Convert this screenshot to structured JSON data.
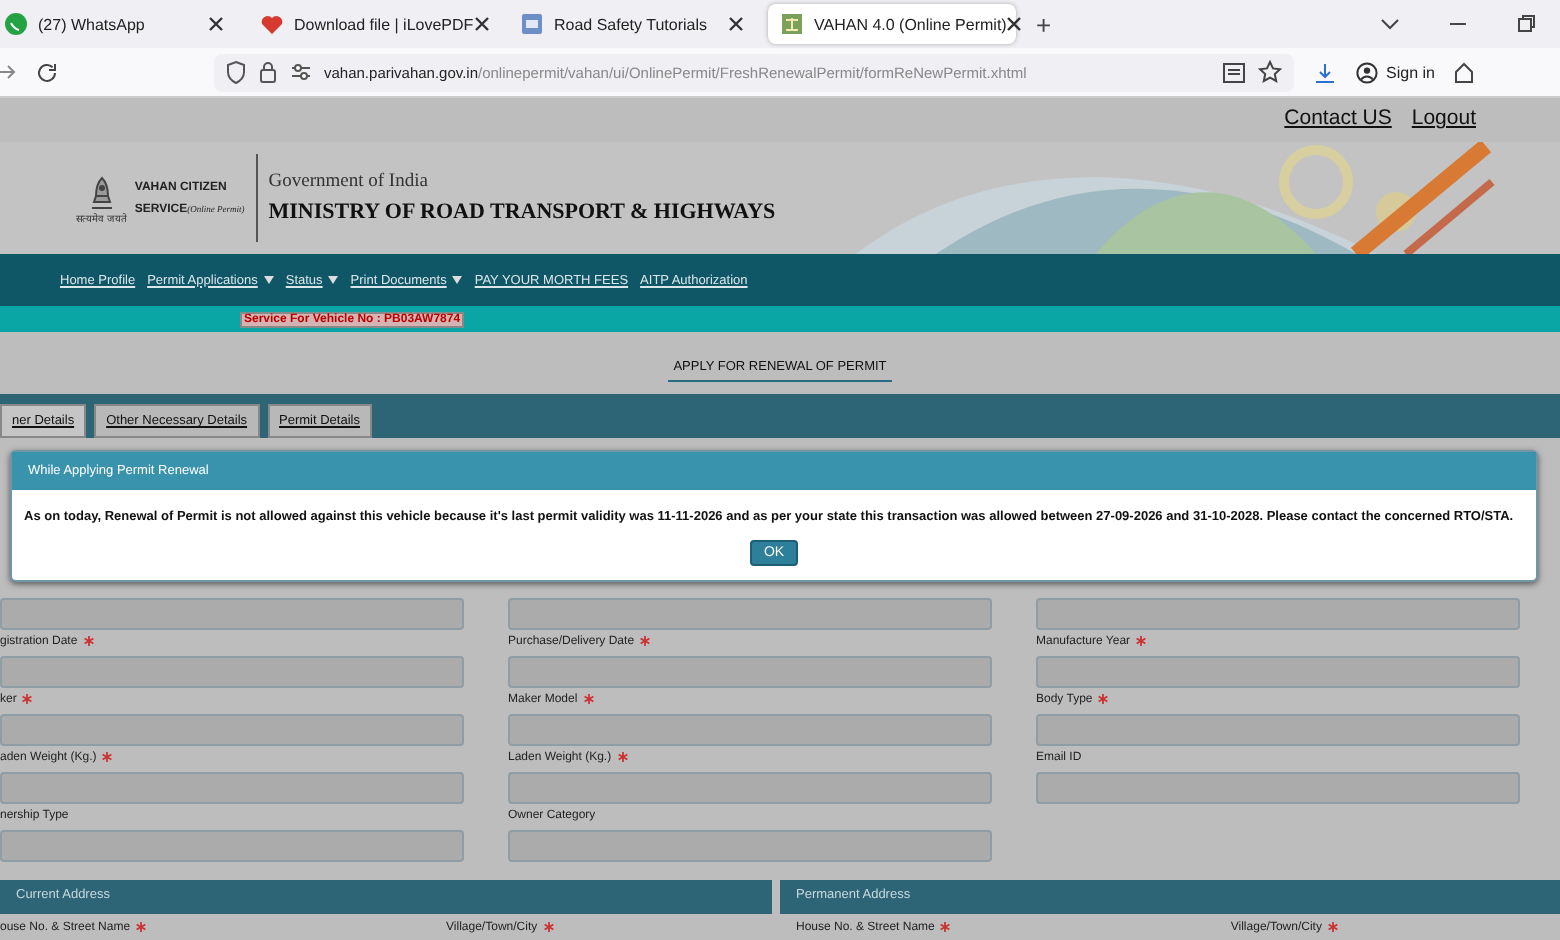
{
  "browser": {
    "tabs": [
      {
        "title": "(27) WhatsApp",
        "selected": false
      },
      {
        "title": "Download file | iLovePDF",
        "selected": false
      },
      {
        "title": "Road Safety Tutorials",
        "selected": false
      },
      {
        "title": "VAHAN 4.0 (Online Permit)",
        "selected": true
      }
    ],
    "new_tab": "+",
    "url_host": "vahan.parivahan.gov.in",
    "url_path": "/onlinepermit/vahan/ui/OnlinePermit/FreshRenewalPermit/formReNewPermit.xhtml",
    "sign_in": "Sign in"
  },
  "top_links": [
    "Contact US",
    "Logout"
  ],
  "header": {
    "brand_line1": "VAHAN CITIZEN",
    "brand_line2": "SERVICE",
    "brand_sub": "(Online Permit)",
    "emblem_caption": "सत्यमेव जयते",
    "gov": "Government of India",
    "ministry": "MINISTRY OF ROAD TRANSPORT & HIGHWAYS"
  },
  "nav": [
    {
      "label": "Home Profile",
      "dropdown": false
    },
    {
      "label": "Permit Applications",
      "dropdown": true
    },
    {
      "label": "Status",
      "dropdown": true
    },
    {
      "label": "Print Documents",
      "dropdown": true
    },
    {
      "label": "PAY YOUR MORTH FEES",
      "dropdown": false
    },
    {
      "label": "AITP Authorization",
      "dropdown": false
    }
  ],
  "service_label": "Service For Vehicle No : PB03AW7874",
  "page_heading": "APPLY FOR RENEWAL OF PERMIT",
  "form_tabs": [
    {
      "label": "ner Details",
      "selected": true
    },
    {
      "label": "Other Necessary Details",
      "selected": false
    },
    {
      "label": "Permit Details",
      "selected": false
    }
  ],
  "form_rows": [
    [
      {
        "kind": "input"
      },
      {
        "kind": "input"
      },
      {
        "kind": "input"
      }
    ],
    [
      {
        "kind": "labeled",
        "label": "gistration Date",
        "required": true
      },
      {
        "kind": "labeled",
        "label": "Purchase/Delivery Date",
        "required": true
      },
      {
        "kind": "labeled",
        "label": "Manufacture Year",
        "required": true
      }
    ],
    [
      {
        "kind": "labeled",
        "label": "ker",
        "required": true
      },
      {
        "kind": "labeled",
        "label": "Maker Model",
        "required": true
      },
      {
        "kind": "labeled",
        "label": "Body Type",
        "required": true
      }
    ],
    [
      {
        "kind": "labeled",
        "label": "aden Weight (Kg.)",
        "required": true
      },
      {
        "kind": "labeled",
        "label": "Laden Weight (Kg.)",
        "required": true
      },
      {
        "kind": "labeled",
        "label": "Email ID",
        "required": false
      }
    ],
    [
      {
        "kind": "labeled",
        "label": "nership Type",
        "required": false
      },
      {
        "kind": "labeled",
        "label": "Owner Category",
        "required": false
      }
    ]
  ],
  "address_panels": [
    {
      "title": "Current Address",
      "fields": [
        {
          "label": "ouse No. & Street Name",
          "required": true
        },
        {
          "label": "Village/Town/City",
          "required": true
        }
      ]
    },
    {
      "title": "Permanent Address",
      "fields": [
        {
          "label": "House No. & Street Name",
          "required": true
        },
        {
          "label": "Village/Town/City",
          "required": true
        }
      ]
    }
  ],
  "dialog": {
    "title": "While Applying Permit Renewal",
    "message": "As on today, Renewal of Permit is not allowed against this vehicle because it's last permit validity was 11-11-2026 and as per your state this transaction was allowed between 27-09-2026 and 31-10-2028. Please contact the concerned RTO/STA.",
    "button": "OK"
  }
}
